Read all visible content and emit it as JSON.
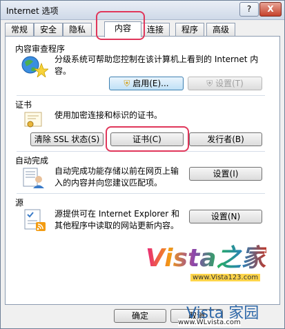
{
  "window": {
    "title": "Internet 选项",
    "help_label": "?",
    "close_label": "X"
  },
  "tabs": [
    "常规",
    "安全",
    "隐私",
    "内容",
    "连接",
    "程序",
    "高级"
  ],
  "sections": {
    "content_advisor": {
      "title": "内容审查程序",
      "description": "分级系统可帮助您控制在该计算机上看到的 Internet 内容。",
      "enable_label": "启用(E)...",
      "settings_label": "设置(T)"
    },
    "certificates": {
      "title": "证书",
      "description": "使用加密连接和标识的证书。",
      "clear_ssl_label": "清除 SSL 状态(S)",
      "certs_label": "证书(C)",
      "publishers_label": "发行者(B)"
    },
    "autocomplete": {
      "title": "自动完成",
      "description": "自动完成功能存储以前在网页上输入的内容并向您建议匹配项。",
      "settings_label": "设置(I)"
    },
    "feeds": {
      "title": "源",
      "description": "源提供可在 Internet Explorer 和其他程序中读取的网站更新内容。",
      "settings_label": "设置(N)"
    }
  },
  "footer": {
    "ok_label": "确定",
    "cancel_label": "取消"
  },
  "watermarks": {
    "logo_text": "Vista之家",
    "logo_url": "www.Vista123.com",
    "brand2": "Vista 家园",
    "brand2_url": "www.WLvista.com"
  },
  "colors": {
    "highlight": "#e0365a",
    "window_border": "#6d7f96"
  }
}
